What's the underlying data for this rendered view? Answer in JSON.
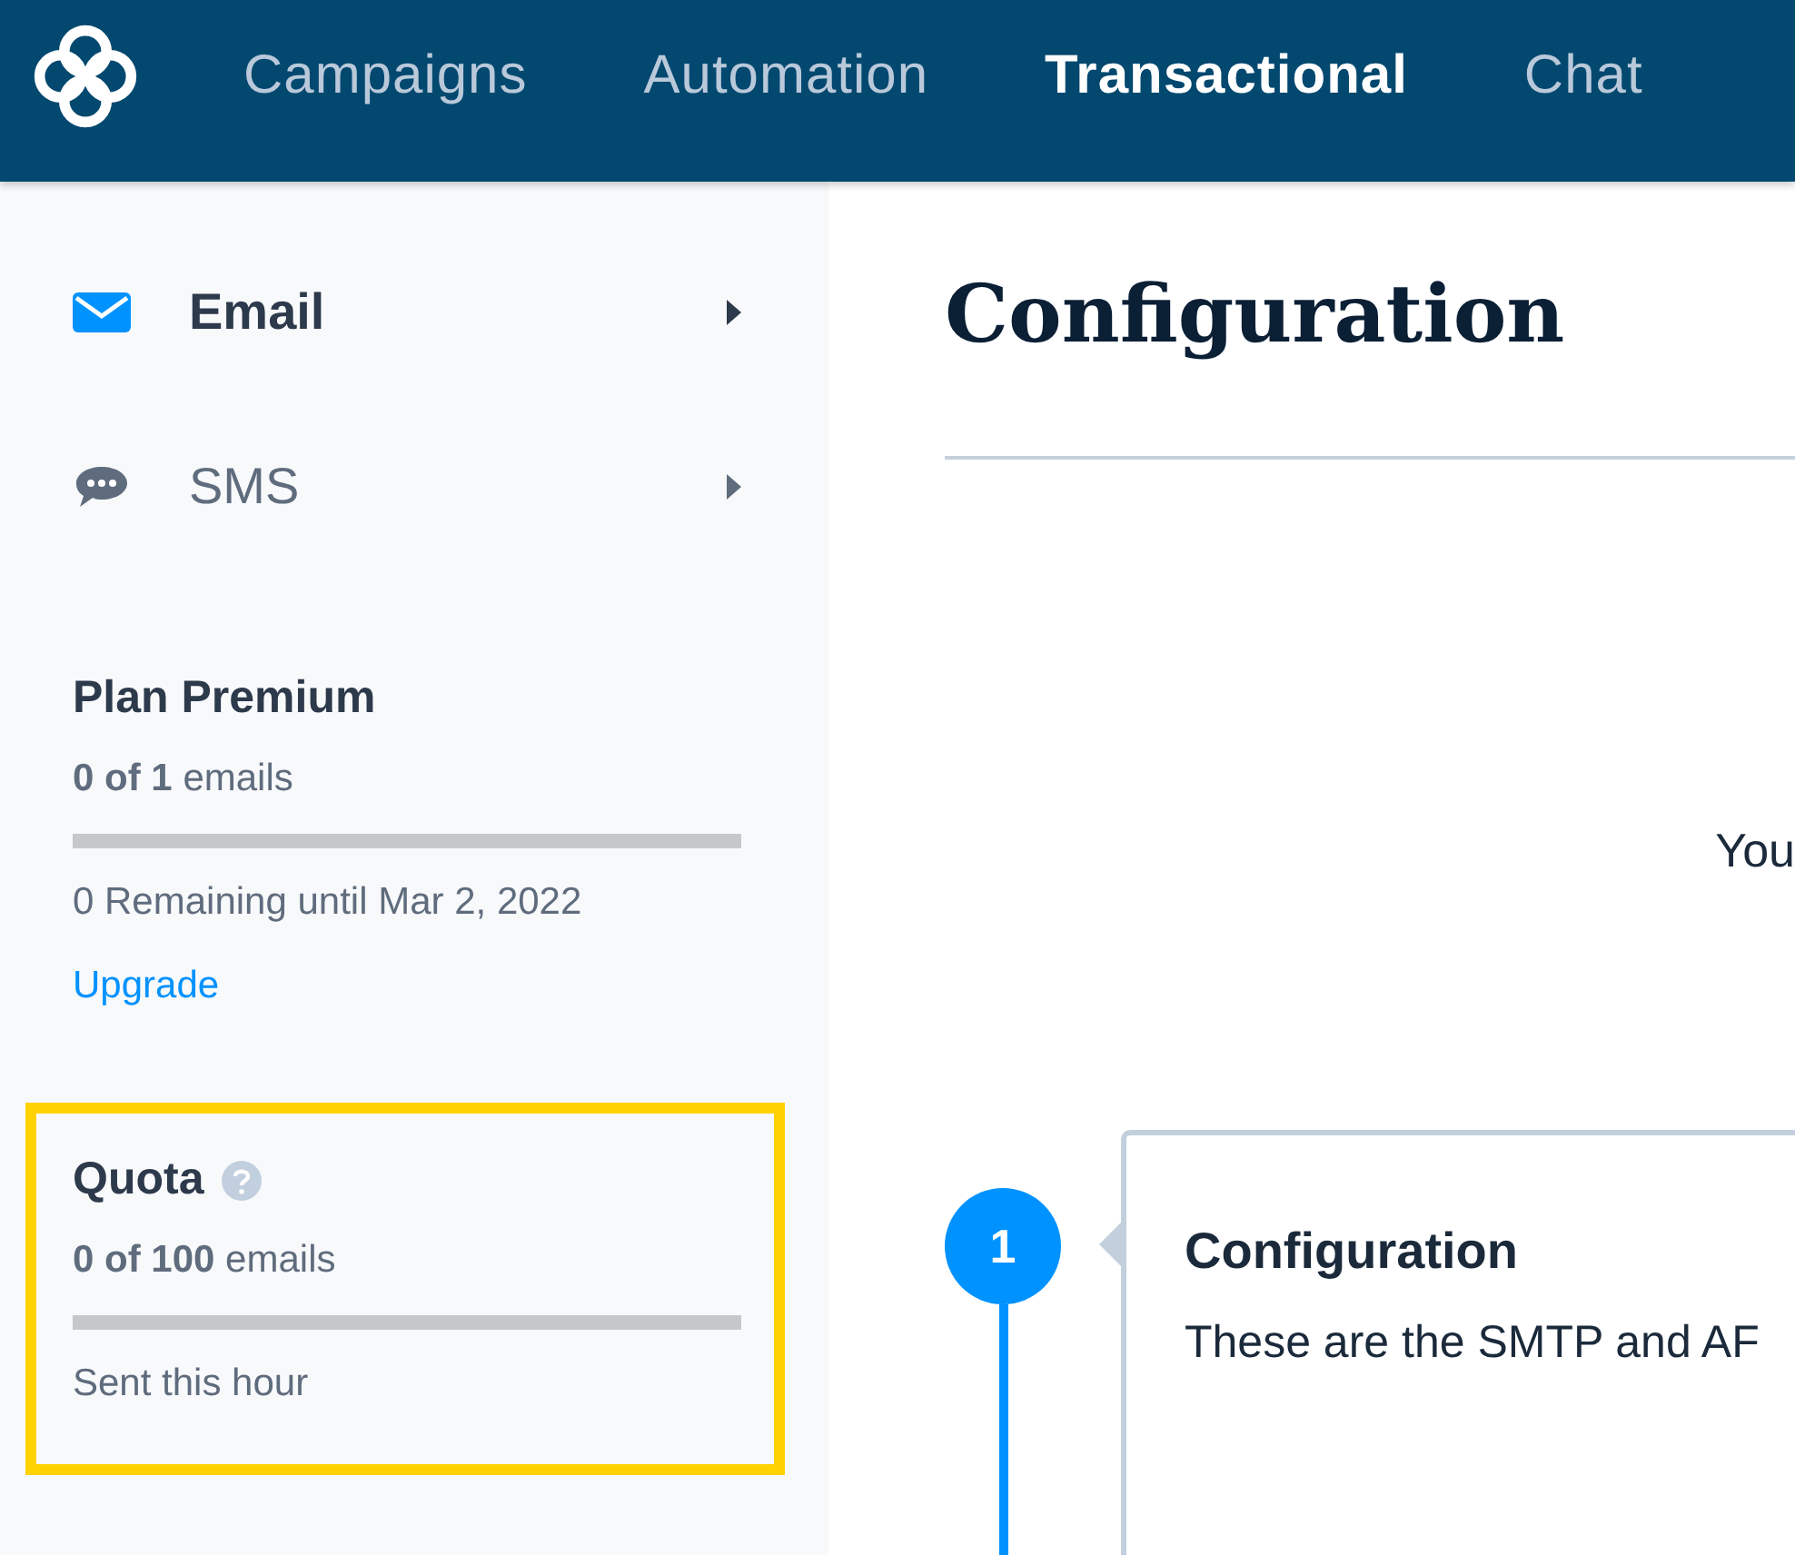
{
  "nav": {
    "items": [
      {
        "label": "Campaigns",
        "selected": false
      },
      {
        "label": "Automation",
        "selected": false
      },
      {
        "label": "Transactional",
        "selected": true
      },
      {
        "label": "Chat",
        "selected": false
      }
    ]
  },
  "sidebar": {
    "items": [
      {
        "label": "Email",
        "kind": "email",
        "selected": true
      },
      {
        "label": "SMS",
        "kind": "sms",
        "selected": false
      }
    ],
    "plan": {
      "title": "Plan Premium",
      "usage": "**0 of 1** emails",
      "level": 0,
      "note": "0 Remaining until Mar 2, 2022",
      "link": "Upgrade"
    },
    "quota": {
      "title": "Quota",
      "usage": "**0 of 100** emails",
      "level": 0,
      "note": "Sent this hour"
    }
  },
  "main": {
    "title": "Configuration",
    "intro": "You",
    "steps": [
      {
        "number": "1",
        "title": "Configuration",
        "text": "These are the SMTP and AF"
      }
    ]
  }
}
